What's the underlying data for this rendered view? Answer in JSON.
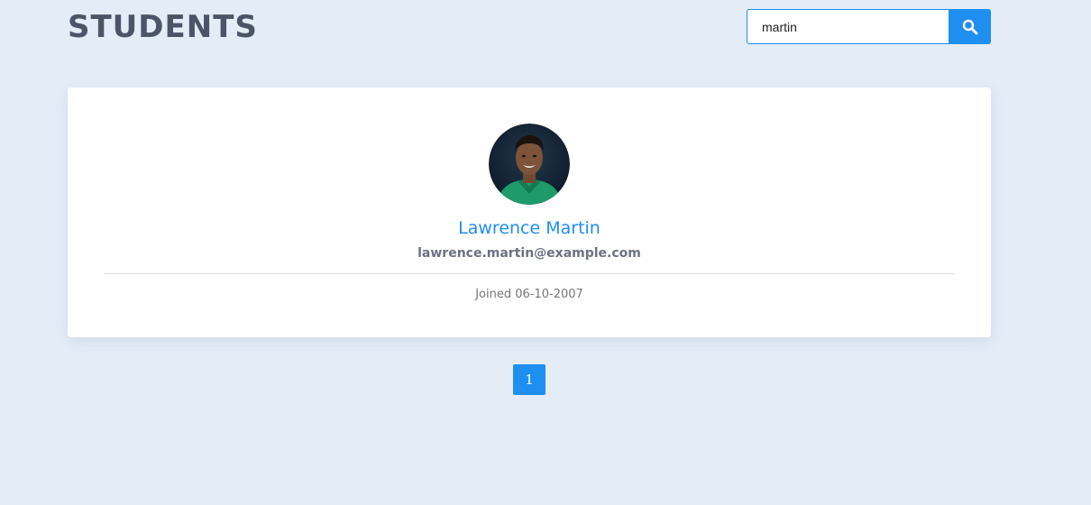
{
  "header": {
    "title": "STUDENTS"
  },
  "search": {
    "value": "martin",
    "button_icon": "search-icon"
  },
  "students": [
    {
      "name": "Lawrence Martin",
      "email": "lawrence.martin@example.com",
      "joined": "Joined 06-10-2007",
      "avatar_icon": "avatar-photo"
    }
  ],
  "pagination": {
    "current_page": "1"
  },
  "colors": {
    "accent": "#1e8ef0",
    "background": "#e4ecf8",
    "title": "#4b5567"
  }
}
